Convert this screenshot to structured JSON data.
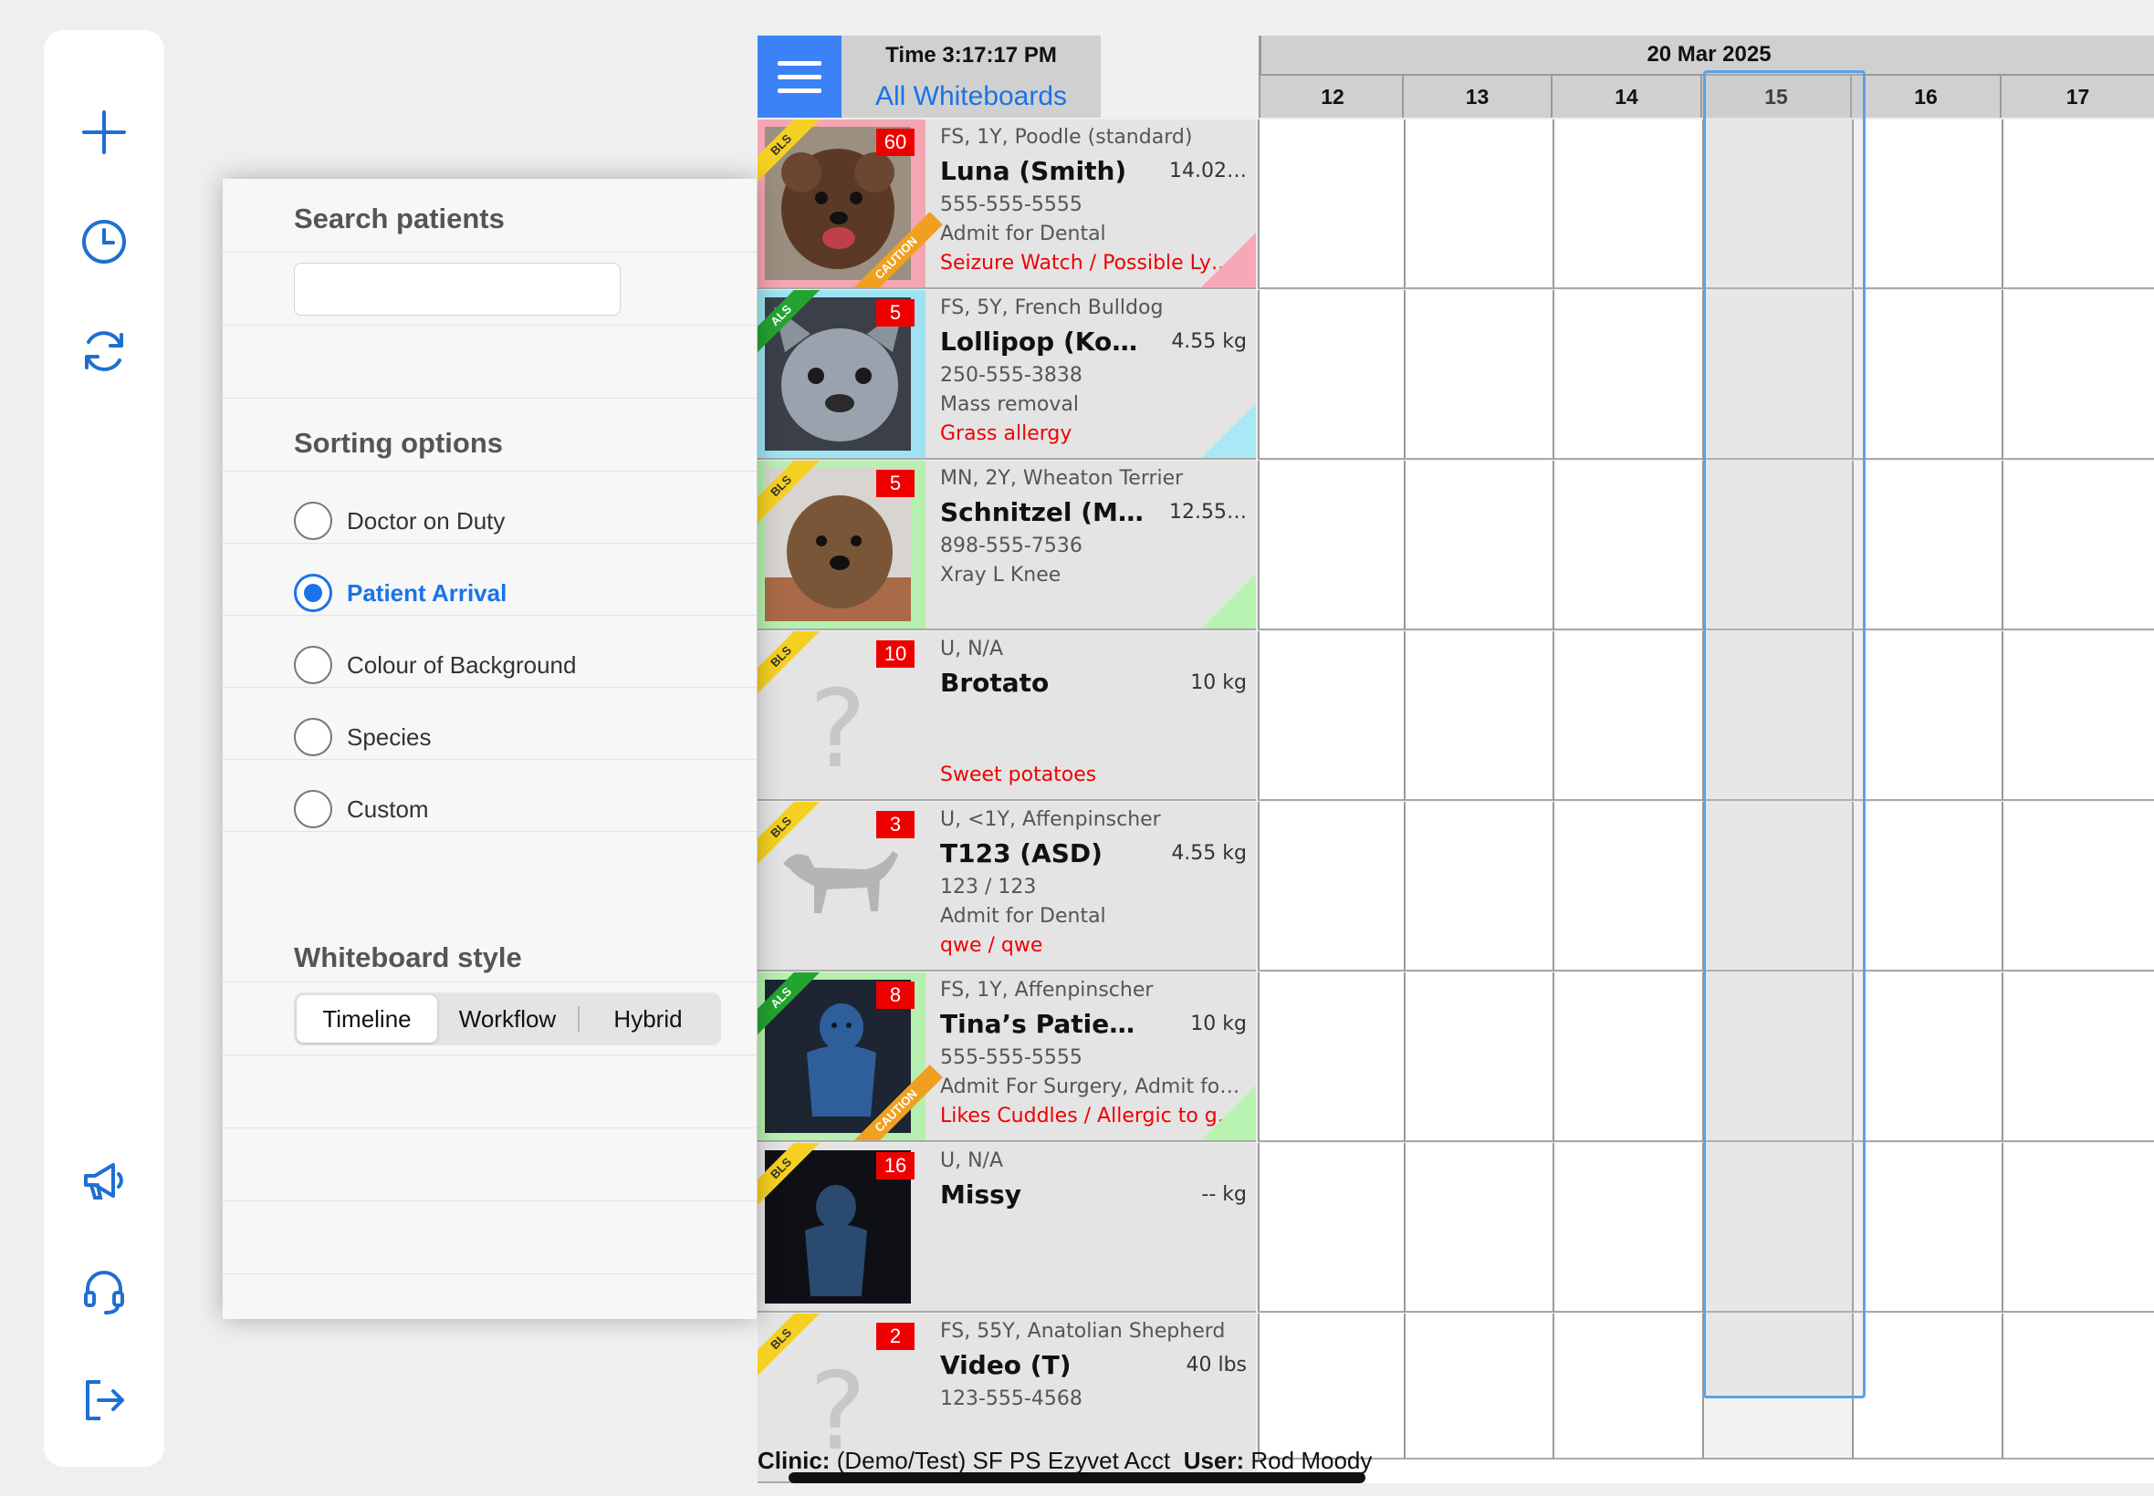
{
  "rail": {
    "top": [
      "plus-icon",
      "clock-icon",
      "refresh-icon"
    ],
    "bottom": [
      "megaphone-icon",
      "headset-icon",
      "logout-icon"
    ]
  },
  "panel": {
    "search_title": "Search patients",
    "search_value": "",
    "sorting_title": "Sorting options",
    "sort_options": [
      "Doctor on Duty",
      "Patient Arrival",
      "Colour of Background",
      "Species",
      "Custom"
    ],
    "sort_selected": "Patient Arrival",
    "style_title": "Whiteboard style",
    "style_options": [
      "Timeline",
      "Workflow",
      "Hybrid"
    ],
    "style_selected": "Timeline"
  },
  "header": {
    "time": "Time 3:17:17 PM",
    "all_whiteboards": "All Whiteboards",
    "date": "20 Mar 2025",
    "days": [
      "12",
      "13",
      "14",
      "15",
      "16",
      "17"
    ],
    "today": "15"
  },
  "patients": [
    {
      "info": "FS, 1Y, Poodle (standard)",
      "name": "Luna (Smith)",
      "weight": "14.02…",
      "line3": "555-555-5555",
      "line4": "Admit for Dental",
      "alert": "Seizure Watch / Possible Ly…",
      "count": "60",
      "level": "BLS",
      "caution": "CAUTION",
      "border": "#f4a6b2",
      "corner": "#f7a8b8",
      "photo": "dog-curly"
    },
    {
      "info": "FS, 5Y, French Bulldog",
      "name": "Lollipop (Kong)",
      "weight": "4.55 kg",
      "line3": "250-555-3838",
      "line4": "Mass removal",
      "alert": "Grass allergy",
      "count": "5",
      "level": "ALS",
      "caution": "",
      "border": "#9fe3f2",
      "corner": "#a9e8f5",
      "photo": "dog-bulldog"
    },
    {
      "info": "MN, 2Y, Wheaton Terrier",
      "name": "Schnitzel (Ma…",
      "weight": "12.55…",
      "line3": "898-555-7536",
      "line4": "Xray L Knee",
      "alert": "",
      "count": "5",
      "level": "BLS",
      "caution": "",
      "border": "#b6f0ae",
      "corner": "#b8f2b0",
      "photo": "dog-terrier"
    },
    {
      "info": "U, N/A",
      "name": "Brotato",
      "weight": "10 kg",
      "line3": "",
      "line4": "",
      "alert": "Sweet potatoes",
      "count": "10",
      "level": "BLS",
      "caution": "",
      "border": "",
      "corner": "",
      "photo": "question"
    },
    {
      "info": "U, <1Y, Affenpinscher",
      "name": "T123 (ASD)",
      "weight": "4.55 kg",
      "line3": "123 / 123",
      "line4": "Admit for Dental",
      "alert": "qwe / qwe",
      "count": "3",
      "level": "BLS",
      "caution": "",
      "border": "",
      "corner": "",
      "photo": "dog-silhouette"
    },
    {
      "info": "FS, 1Y, Affenpinscher",
      "name": "Tina’s Patient…",
      "weight": "10 kg",
      "line3": "555-555-5555",
      "line4": "Admit For Surgery, Admit fo…",
      "alert": "Likes Cuddles / Allergic to g…",
      "count": "8",
      "level": "ALS",
      "caution": "CAUTION",
      "border": "#b6f0ae",
      "corner": "#b8f2b0",
      "photo": "toy-blue"
    },
    {
      "info": "U, N/A",
      "name": "Missy",
      "weight": "-- kg",
      "line3": "",
      "line4": "",
      "alert": "",
      "count": "16",
      "level": "BLS",
      "caution": "",
      "border": "",
      "corner": "",
      "photo": "toy-dark"
    },
    {
      "info": "FS, 55Y, Anatolian Shepherd",
      "name": "Video (T)",
      "weight": "40 lbs",
      "line3": "123-555-4568",
      "line4": "",
      "alert": "",
      "count": "2",
      "level": "BLS",
      "caution": "",
      "border": "",
      "corner": "",
      "photo": "question"
    }
  ],
  "footer": {
    "clinic_label": "Clinic:",
    "clinic": "(Demo/Test) SF PS Ezyvet Acct",
    "user_label": "User:",
    "user": "Rod Moody"
  },
  "colors": {
    "accent": "#1a73e8",
    "menu": "#3b82f6",
    "alert": "#e00000",
    "today_outline": "#5aa3e6"
  }
}
